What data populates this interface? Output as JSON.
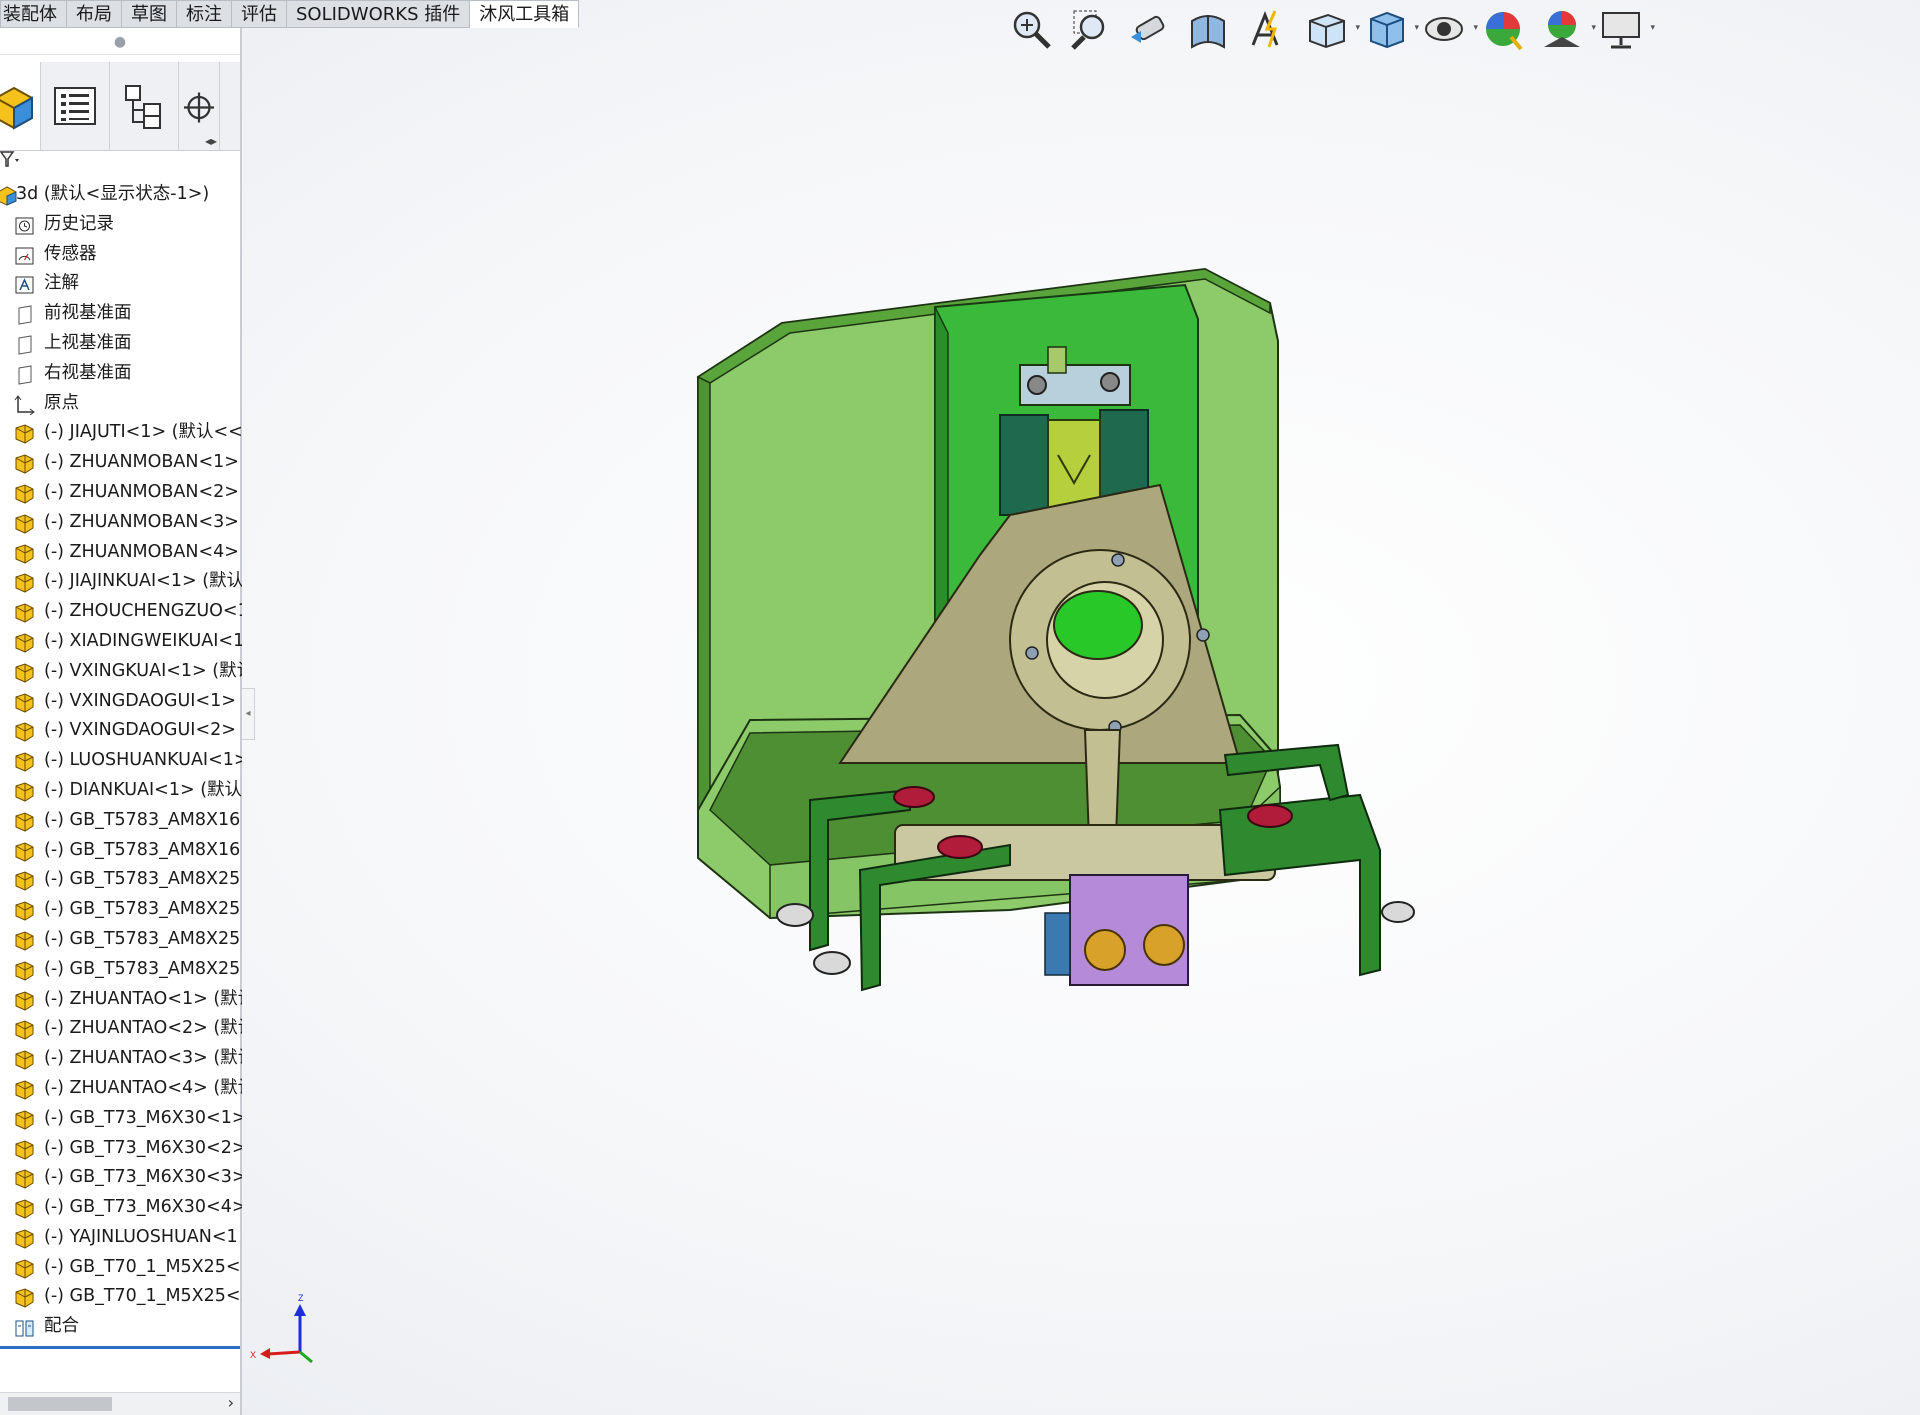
{
  "command_tabs": [
    {
      "label": "装配体"
    },
    {
      "label": "布局"
    },
    {
      "label": "草图"
    },
    {
      "label": "标注"
    },
    {
      "label": "评估"
    },
    {
      "label": "SOLIDWORKS 插件"
    },
    {
      "label": "沐风工具箱",
      "active": true
    }
  ],
  "panel": {
    "tabs": [
      {
        "icon": "featuremanager-tree-icon",
        "active": true
      },
      {
        "icon": "propertymanager-icon"
      },
      {
        "icon": "configurationmanager-icon"
      },
      {
        "icon": "dimxpert-icon"
      }
    ],
    "filter_icon": "filter-icon"
  },
  "tree": {
    "root": "3d  (默认<显示状态-1>)",
    "system_items": [
      {
        "label": "历史记录",
        "icon": "history-icon"
      },
      {
        "label": "传感器",
        "icon": "sensor-icon"
      },
      {
        "label": "注解",
        "icon": "annotations-icon"
      },
      {
        "label": "前视基准面",
        "icon": "plane-icon"
      },
      {
        "label": "上视基准面",
        "icon": "plane-icon"
      },
      {
        "label": "右视基准面",
        "icon": "plane-icon"
      },
      {
        "label": "原点",
        "icon": "origin-icon"
      }
    ],
    "components": [
      "(-) JIAJUTI<1> (默认<<",
      "(-) ZHUANMOBAN<1>",
      "(-) ZHUANMOBAN<2>",
      "(-) ZHUANMOBAN<3>",
      "(-) ZHUANMOBAN<4>",
      "(-) JIAJINKUAI<1> (默认",
      "(-) ZHOUCHENGZUO<1",
      "(-) XIADINGWEIKUAI<1",
      "(-) VXINGKUAI<1> (默认",
      "(-) VXINGDAOGUI<1> (",
      "(-) VXINGDAOGUI<2> (",
      "(-) LUOSHUANKUAI<1>",
      "(-) DIANKUAI<1> (默认",
      "(-) GB_T5783_AM8X16<",
      "(-) GB_T5783_AM8X16<",
      "(-) GB_T5783_AM8X25<",
      "(-) GB_T5783_AM8X25<",
      "(-) GB_T5783_AM8X25<",
      "(-) GB_T5783_AM8X25<",
      "(-) ZHUANTAO<1> (默认",
      "(-) ZHUANTAO<2> (默认",
      "(-) ZHUANTAO<3> (默认",
      "(-) ZHUANTAO<4> (默认",
      "(-) GB_T73_M6X30<1> (",
      "(-) GB_T73_M6X30<2> (",
      "(-) GB_T73_M6X30<3> (",
      "(-) GB_T73_M6X30<4> (",
      "(-) YAJINLUOSHUAN<1",
      "(-) GB_T70_1_M5X25<1",
      "(-) GB_T70_1_M5X25<2"
    ],
    "mates": "配合"
  },
  "heads_up_toolbar": [
    {
      "icon": "zoom-to-fit-icon"
    },
    {
      "icon": "zoom-to-area-icon"
    },
    {
      "icon": "previous-view-icon"
    },
    {
      "icon": "section-view-icon"
    },
    {
      "icon": "dynamic-annotation-view-icon"
    },
    {
      "icon": "view-orientation-icon",
      "dropdown": true
    },
    {
      "icon": "display-style-icon",
      "dropdown": true
    },
    {
      "icon": "hide-show-items-icon",
      "dropdown": true
    },
    {
      "icon": "edit-appearance-icon"
    },
    {
      "icon": "apply-scene-icon",
      "dropdown": true
    },
    {
      "icon": "view-settings-icon",
      "dropdown": true
    }
  ],
  "triad": {
    "z": "Z",
    "x": "X"
  },
  "colors": {
    "fixture_body": "#8cc96a",
    "fixture_edge": "#2e4a1f",
    "bracket_green": "#2f8a2f",
    "clamp_block": "#1f6a4f",
    "bearing_seat": "#b9b78a",
    "screw_block": "#b58ad8",
    "bolt_gold": "#d8a22a",
    "washer_red": "#b01c3a"
  }
}
